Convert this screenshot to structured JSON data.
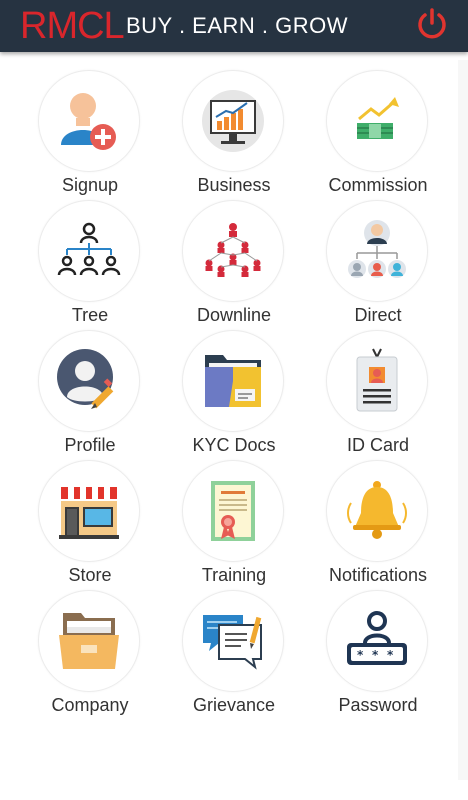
{
  "header": {
    "logo": "RMCL",
    "tagline": "BUY . EARN . GROW",
    "power_icon": "power-icon",
    "brand_color": "#d9262c",
    "bar_color": "#263341"
  },
  "menu": {
    "items": [
      {
        "label": "Signup",
        "icon": "user-add-icon"
      },
      {
        "label": "Business",
        "icon": "growth-chart-icon"
      },
      {
        "label": "Commission",
        "icon": "money-stack-icon"
      },
      {
        "label": "Tree",
        "icon": "org-tree-icon"
      },
      {
        "label": "Downline",
        "icon": "downline-network-icon"
      },
      {
        "label": "Direct",
        "icon": "direct-team-icon"
      },
      {
        "label": "Profile",
        "icon": "profile-edit-icon"
      },
      {
        "label": "KYC Docs",
        "icon": "folder-docs-icon"
      },
      {
        "label": "ID Card",
        "icon": "id-badge-icon"
      },
      {
        "label": "Store",
        "icon": "storefront-icon"
      },
      {
        "label": "Training",
        "icon": "certificate-icon"
      },
      {
        "label": "Notifications",
        "icon": "bell-icon"
      },
      {
        "label": "Company",
        "icon": "file-cabinet-icon"
      },
      {
        "label": "Grievance",
        "icon": "chat-note-icon"
      },
      {
        "label": "Password",
        "icon": "password-lock-icon"
      }
    ]
  }
}
